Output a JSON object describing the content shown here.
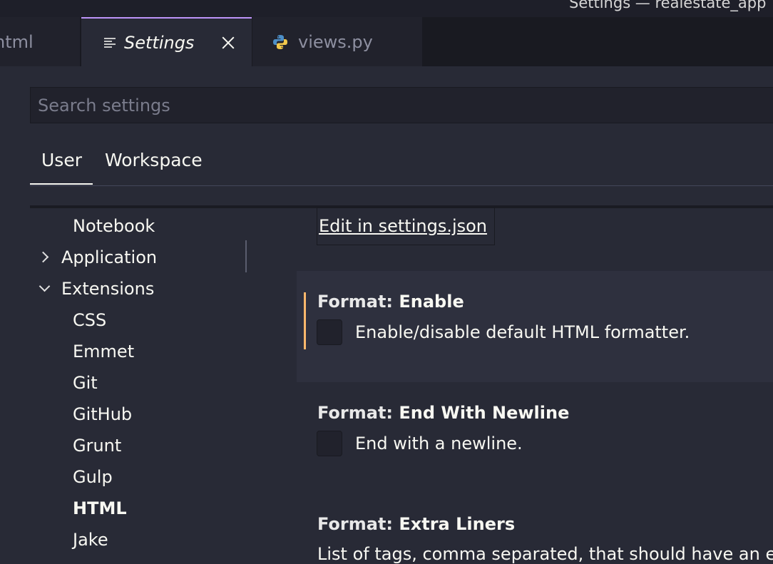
{
  "window": {
    "title": "Settings — realestate_app"
  },
  "tabs": [
    {
      "label": "html"
    },
    {
      "label": "Settings",
      "close_icon": "close-icon"
    },
    {
      "label": "views.py"
    }
  ],
  "search": {
    "placeholder": "Search settings"
  },
  "scopes": {
    "user": "User",
    "workspace": "Workspace"
  },
  "tree": {
    "notebook": "Notebook",
    "application": "Application",
    "extensions": "Extensions",
    "css": "CSS",
    "emmet": "Emmet",
    "git": "Git",
    "github": "GitHub",
    "grunt": "Grunt",
    "gulp": "Gulp",
    "html": "HTML",
    "jake": "Jake"
  },
  "edit_link": "Edit in settings.json",
  "settings": [
    {
      "category": "Format: ",
      "name": "Enable",
      "description": "Enable/disable default HTML formatter."
    },
    {
      "category": "Format: ",
      "name": "End With Newline",
      "description": "End with a newline."
    },
    {
      "category": "Format: ",
      "name": "Extra Liners",
      "description": "List of tags, comma separated, that should have an e"
    }
  ],
  "colors": {
    "accent": "#bd93f9",
    "modified": "#ffb86c",
    "background": "#282a36"
  }
}
